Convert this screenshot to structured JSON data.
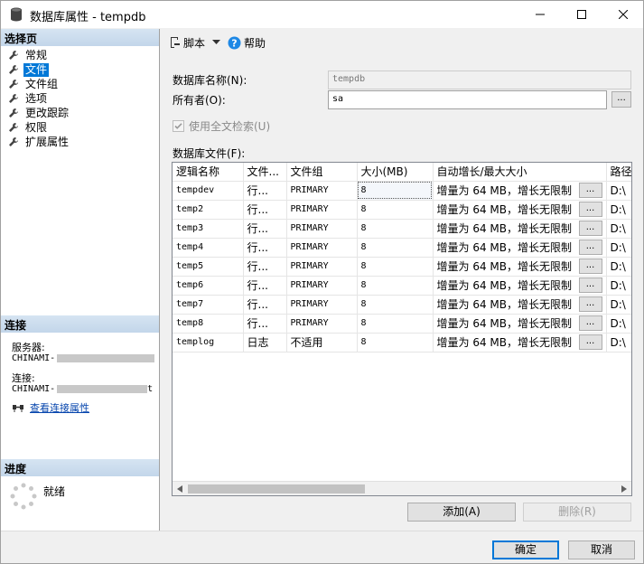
{
  "window": {
    "title": "数据库属性 - tempdb"
  },
  "left": {
    "select_page_header": "选择页",
    "pages": [
      {
        "label": "常规",
        "selected": false
      },
      {
        "label": "文件",
        "selected": true
      },
      {
        "label": "文件组",
        "selected": false
      },
      {
        "label": "选项",
        "selected": false
      },
      {
        "label": "更改跟踪",
        "selected": false
      },
      {
        "label": "权限",
        "selected": false
      },
      {
        "label": "扩展属性",
        "selected": false
      }
    ],
    "connection_header": "连接",
    "server_label": "服务器:",
    "server_value": "CHINAMI-",
    "connection_label": "连接:",
    "connection_value": "CHINAMI-",
    "connection_suffix": "t",
    "view_connection_link": "查看连接属性",
    "progress_header": "进度",
    "progress_status": "就绪"
  },
  "toolbar": {
    "script_label": "脚本",
    "help_label": "帮助"
  },
  "form": {
    "db_name_label": "数据库名称(N):",
    "db_name_value": "tempdb",
    "owner_label": "所有者(O):",
    "owner_value": "sa",
    "browse_button": "...",
    "fulltext_label": "使用全文检索(U)",
    "fulltext_checked": true,
    "files_label": "数据库文件(F):"
  },
  "grid": {
    "columns": [
      "逻辑名称",
      "文件...",
      "文件组",
      "大小(MB)",
      "自动增长/最大大小",
      "路径"
    ],
    "rows": [
      {
        "name": "tempdev",
        "type": "行...",
        "group": "PRIMARY",
        "size": "8",
        "growth": "增量为 64 MB，增长无限制",
        "path": "D:\\"
      },
      {
        "name": "temp2",
        "type": "行...",
        "group": "PRIMARY",
        "size": "8",
        "growth": "增量为 64 MB，增长无限制",
        "path": "D:\\"
      },
      {
        "name": "temp3",
        "type": "行...",
        "group": "PRIMARY",
        "size": "8",
        "growth": "增量为 64 MB，增长无限制",
        "path": "D:\\"
      },
      {
        "name": "temp4",
        "type": "行...",
        "group": "PRIMARY",
        "size": "8",
        "growth": "增量为 64 MB，增长无限制",
        "path": "D:\\"
      },
      {
        "name": "temp5",
        "type": "行...",
        "group": "PRIMARY",
        "size": "8",
        "growth": "增量为 64 MB，增长无限制",
        "path": "D:\\"
      },
      {
        "name": "temp6",
        "type": "行...",
        "group": "PRIMARY",
        "size": "8",
        "growth": "增量为 64 MB，增长无限制",
        "path": "D:\\"
      },
      {
        "name": "temp7",
        "type": "行...",
        "group": "PRIMARY",
        "size": "8",
        "growth": "增量为 64 MB，增长无限制",
        "path": "D:\\"
      },
      {
        "name": "temp8",
        "type": "行...",
        "group": "PRIMARY",
        "size": "8",
        "growth": "增量为 64 MB，增长无限制",
        "path": "D:\\"
      },
      {
        "name": "templog",
        "type": "日志",
        "group": "不适用",
        "size": "8",
        "growth": "增量为 64 MB，增长无限制",
        "path": "D:\\"
      }
    ],
    "ellipsis": "..."
  },
  "buttons": {
    "add": "添加(A)",
    "remove": "删除(R)",
    "ok": "确定",
    "cancel": "取消"
  },
  "colors": {
    "selection": "#0078d7",
    "section_header": "#c3d6ea",
    "help_icon": "#1e88e5"
  }
}
